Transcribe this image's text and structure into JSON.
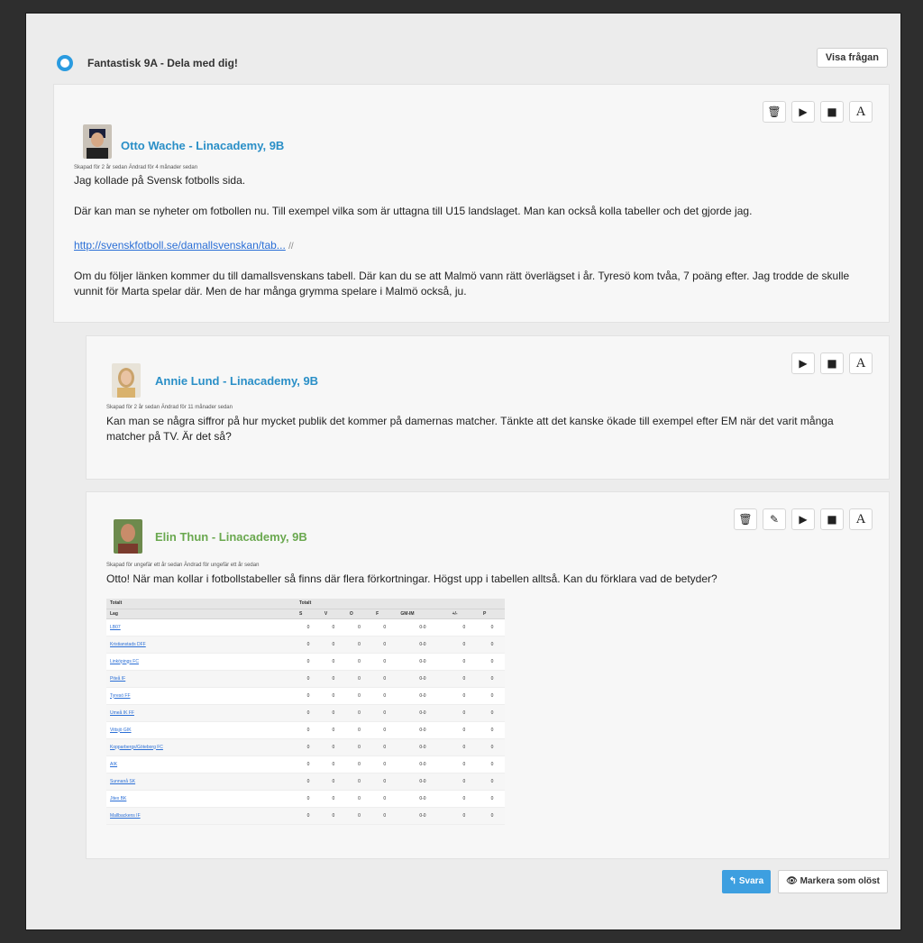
{
  "header": {
    "title": "Fantastisk 9A - Dela med dig!",
    "show_question": "Visa frågan"
  },
  "posts": [
    {
      "author": "Otto Wache - Linacademy, 9B",
      "meta": "Skapad för 2 år sedan Ändrad för 4 månader sedan",
      "paragraphs": [
        "Jag kollade på Svensk fotbolls sida.",
        "Där kan man se nyheter om fotbollen nu. Till exempel vilka som är uttagna till U15 landslaget. Man kan också kolla tabeller och det gjorde jag.",
        "Om du följer länken kommer du till damallsvenskans tabell. Där kan du se att Malmö vann rätt överlägset i år. Tyresö kom tvåa, 7 poäng efter. Jag trodde de skulle vunnit för Marta spelar där. Men de har många grymma spelare i Malmö också, ju."
      ],
      "link": "http://svenskfotboll.se/damallsvenskan/tab...",
      "link_tail": "//"
    },
    {
      "author": "Annie Lund - Linacademy, 9B",
      "meta": "Skapad för 2 år sedan Ändrad för 11 månader sedan",
      "paragraphs": [
        "Kan man se några siffror på hur mycket publik det kommer på damernas matcher. Tänkte att det kanske ökade till exempel efter EM när det varit många matcher på TV. Är det så?"
      ]
    },
    {
      "author": "Elin Thun - Linacademy, 9B",
      "meta": "Skapad för ungefär ett år sedan Ändrad för ungefär ett år sedan",
      "paragraphs": [
        "Otto! När man kollar i fotbollstabeller så finns där flera förkortningar. Högst upp i tabellen alltså. Kan du förklara vad de betyder?"
      ]
    }
  ],
  "table": {
    "caption_left": "Totalt",
    "caption_right": "Totalt",
    "headers": [
      "Lag",
      "S",
      "V",
      "O",
      "F",
      "GM-IM",
      "+/-",
      "P"
    ],
    "rows": [
      [
        "LB07",
        "0",
        "0",
        "0",
        "0",
        "0-0",
        "0",
        "0"
      ],
      [
        "Kristianstads DFF",
        "0",
        "0",
        "0",
        "0",
        "0-0",
        "0",
        "0"
      ],
      [
        "Linköpings FC",
        "0",
        "0",
        "0",
        "0",
        "0-0",
        "0",
        "0"
      ],
      [
        "Piteå IF",
        "0",
        "0",
        "0",
        "0",
        "0-0",
        "0",
        "0"
      ],
      [
        "Tyresö FF",
        "0",
        "0",
        "0",
        "0",
        "0-0",
        "0",
        "0"
      ],
      [
        "Umeå IK FF",
        "0",
        "0",
        "0",
        "0",
        "0-0",
        "0",
        "0"
      ],
      [
        "Vittsjö GIK",
        "0",
        "0",
        "0",
        "0",
        "0-0",
        "0",
        "0"
      ],
      [
        "Kopparbergs/Göteborg FC",
        "0",
        "0",
        "0",
        "0",
        "0-0",
        "0",
        "0"
      ],
      [
        "AIK",
        "0",
        "0",
        "0",
        "0",
        "0-0",
        "0",
        "0"
      ],
      [
        "Sunnanå SK",
        "0",
        "0",
        "0",
        "0",
        "0-0",
        "0",
        "0"
      ],
      [
        "Jitex BK",
        "0",
        "0",
        "0",
        "0",
        "0-0",
        "0",
        "0"
      ],
      [
        "Mallbackens IF",
        "0",
        "0",
        "0",
        "0",
        "0-0",
        "0",
        "0"
      ]
    ]
  },
  "footer": {
    "reply_label": "Svara",
    "mark_label": "Markera som olöst"
  },
  "icons": {
    "trash": "trash-icon",
    "play": "play-icon",
    "stop": "stop-icon",
    "text": "text-size-icon",
    "edit": "pencil-icon"
  },
  "colors": {
    "accent": "#2a9be0",
    "author_otto": "#2a8fc7",
    "author_annie": "#2a8fc7",
    "author_elin": "#6aa84f"
  }
}
